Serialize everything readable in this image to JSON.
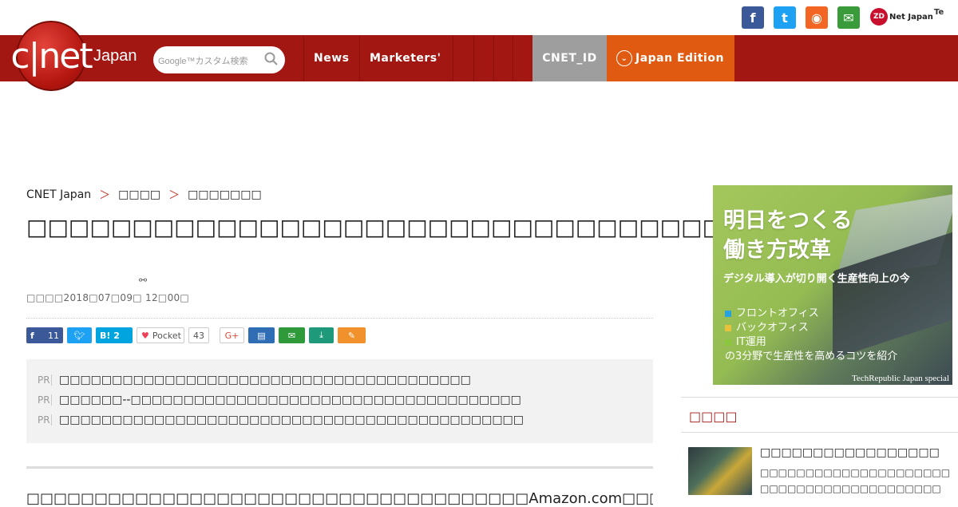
{
  "topbar": {
    "sns": [
      {
        "name": "facebook",
        "color": "#3b5998",
        "glyph": "f"
      },
      {
        "name": "twitter",
        "color": "#1da1f2",
        "glyph": "t"
      },
      {
        "name": "rss",
        "color": "#f26522",
        "glyph": "◉"
      },
      {
        "name": "mail",
        "color": "#3a9b3a",
        "glyph": "✉"
      }
    ],
    "zdnet_label": "Net Japan",
    "zdnet_mark": "ZD",
    "tr_label": "Te"
  },
  "nav": {
    "logo_text": "c|net",
    "logo_sub": "Japan",
    "search_placeholder": "Google™カスタム検索",
    "items": [
      "News",
      "Marketers'"
    ],
    "cnet_id": "CNET_ID",
    "edition": "Japan Edition"
  },
  "breadcrumb": [
    "CNET Japan",
    "＞",
    "□□□□",
    "＞",
    "□□□□□□□"
  ],
  "article": {
    "title": "□□□□□□□□□□□□□□□□□□□□□□□□□□□□□□□□□□",
    "date": "□□□□2018□07□09□ 12□00□",
    "share": {
      "facebook_count": "11",
      "hatena": "B! 2",
      "pocket": "Pocket",
      "pocket_count": "43",
      "gplus": "G+"
    },
    "pr": [
      {
        "tag": "PR",
        "text": "□□□□□□□□□□□□□□□□□□□□□□□□□□□□□□□□□□□□□□□"
      },
      {
        "tag": "PR",
        "text": "□□□□□□--□□□□□□□□□□□□□□□□□□□□□□□□□□□□□□□□□□□□□"
      },
      {
        "tag": "PR",
        "text": "□□□□□□□□□□□□□□□□□□□□□□□□□□□□□□□□□□□□□□□□□□□□"
      }
    ],
    "body": "□□□□□□□□□□□□□□□□□□□□□□□□□□□□□□□□□□□□□Amazon.com□□□□□□□□□□□□□□□□□□□□□□□□□□"
  },
  "ad": {
    "headline1": "明日をつくる",
    "headline2": "働き方改革",
    "subtitle": "デジタル導入が切り開く生産性向上の今",
    "list": [
      {
        "text": "フロントオフィス",
        "color": "#29a3e0"
      },
      {
        "text": "バックオフィス",
        "color": "#e8c23a"
      },
      {
        "text": "IT運用",
        "color": "#8cc63f"
      }
    ],
    "note": "の3分野で生産性を高めるコツを紹介",
    "footer": "TechRepublic Japan special"
  },
  "sidebar": {
    "section_title": "□□□□",
    "item": {
      "title": "□□□□□□□□□□□□□□□□□",
      "desc1": "□□□□□□□□□□□□□□□□□□□□□",
      "desc2": "□□□□□□□□□□□□□□□□□□□□"
    }
  }
}
